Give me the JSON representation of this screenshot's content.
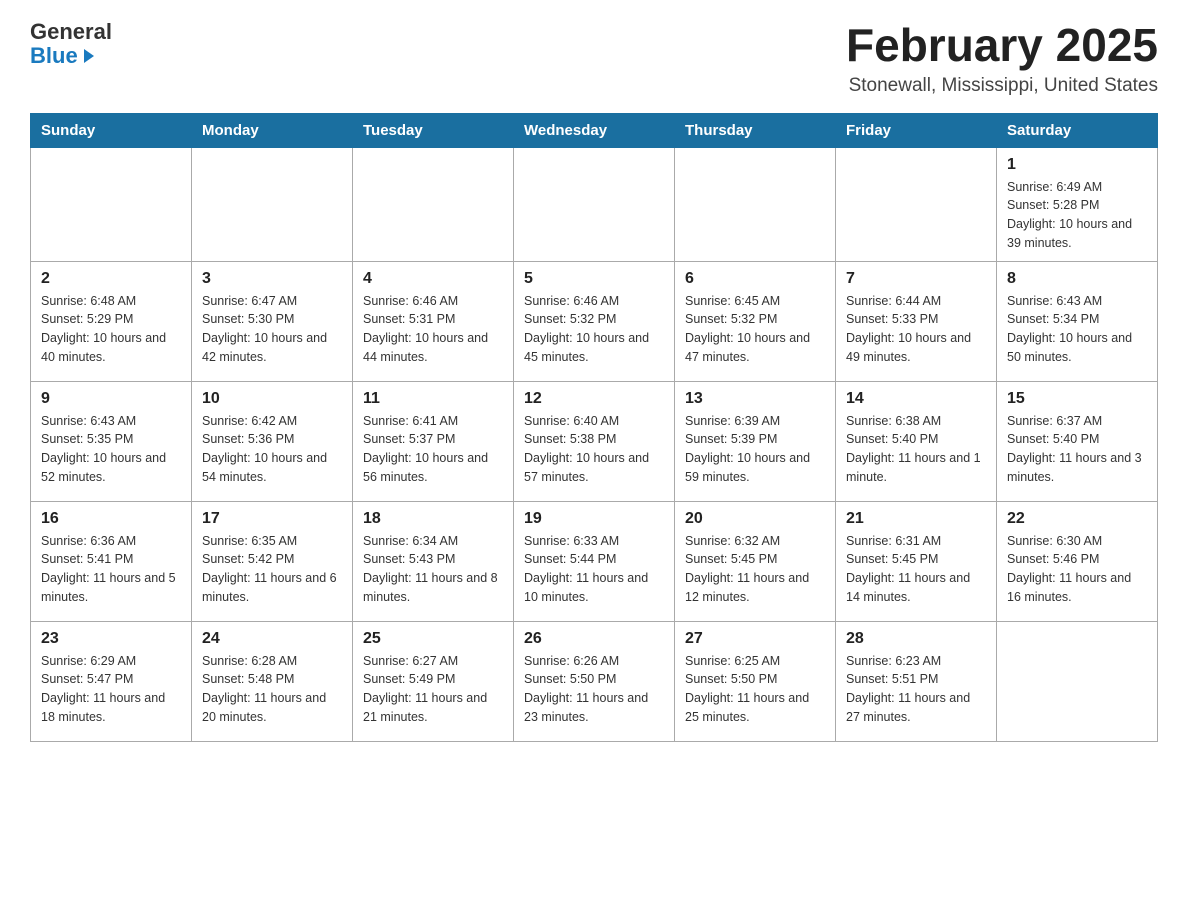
{
  "header": {
    "logo": {
      "general": "General",
      "blue": "Blue"
    },
    "title": "February 2025",
    "location": "Stonewall, Mississippi, United States"
  },
  "days_of_week": [
    "Sunday",
    "Monday",
    "Tuesday",
    "Wednesday",
    "Thursday",
    "Friday",
    "Saturday"
  ],
  "weeks": [
    [
      {
        "day": "",
        "sunrise": "",
        "sunset": "",
        "daylight": ""
      },
      {
        "day": "",
        "sunrise": "",
        "sunset": "",
        "daylight": ""
      },
      {
        "day": "",
        "sunrise": "",
        "sunset": "",
        "daylight": ""
      },
      {
        "day": "",
        "sunrise": "",
        "sunset": "",
        "daylight": ""
      },
      {
        "day": "",
        "sunrise": "",
        "sunset": "",
        "daylight": ""
      },
      {
        "day": "",
        "sunrise": "",
        "sunset": "",
        "daylight": ""
      },
      {
        "day": "1",
        "sunrise": "Sunrise: 6:49 AM",
        "sunset": "Sunset: 5:28 PM",
        "daylight": "Daylight: 10 hours and 39 minutes."
      }
    ],
    [
      {
        "day": "2",
        "sunrise": "Sunrise: 6:48 AM",
        "sunset": "Sunset: 5:29 PM",
        "daylight": "Daylight: 10 hours and 40 minutes."
      },
      {
        "day": "3",
        "sunrise": "Sunrise: 6:47 AM",
        "sunset": "Sunset: 5:30 PM",
        "daylight": "Daylight: 10 hours and 42 minutes."
      },
      {
        "day": "4",
        "sunrise": "Sunrise: 6:46 AM",
        "sunset": "Sunset: 5:31 PM",
        "daylight": "Daylight: 10 hours and 44 minutes."
      },
      {
        "day": "5",
        "sunrise": "Sunrise: 6:46 AM",
        "sunset": "Sunset: 5:32 PM",
        "daylight": "Daylight: 10 hours and 45 minutes."
      },
      {
        "day": "6",
        "sunrise": "Sunrise: 6:45 AM",
        "sunset": "Sunset: 5:32 PM",
        "daylight": "Daylight: 10 hours and 47 minutes."
      },
      {
        "day": "7",
        "sunrise": "Sunrise: 6:44 AM",
        "sunset": "Sunset: 5:33 PM",
        "daylight": "Daylight: 10 hours and 49 minutes."
      },
      {
        "day": "8",
        "sunrise": "Sunrise: 6:43 AM",
        "sunset": "Sunset: 5:34 PM",
        "daylight": "Daylight: 10 hours and 50 minutes."
      }
    ],
    [
      {
        "day": "9",
        "sunrise": "Sunrise: 6:43 AM",
        "sunset": "Sunset: 5:35 PM",
        "daylight": "Daylight: 10 hours and 52 minutes."
      },
      {
        "day": "10",
        "sunrise": "Sunrise: 6:42 AM",
        "sunset": "Sunset: 5:36 PM",
        "daylight": "Daylight: 10 hours and 54 minutes."
      },
      {
        "day": "11",
        "sunrise": "Sunrise: 6:41 AM",
        "sunset": "Sunset: 5:37 PM",
        "daylight": "Daylight: 10 hours and 56 minutes."
      },
      {
        "day": "12",
        "sunrise": "Sunrise: 6:40 AM",
        "sunset": "Sunset: 5:38 PM",
        "daylight": "Daylight: 10 hours and 57 minutes."
      },
      {
        "day": "13",
        "sunrise": "Sunrise: 6:39 AM",
        "sunset": "Sunset: 5:39 PM",
        "daylight": "Daylight: 10 hours and 59 minutes."
      },
      {
        "day": "14",
        "sunrise": "Sunrise: 6:38 AM",
        "sunset": "Sunset: 5:40 PM",
        "daylight": "Daylight: 11 hours and 1 minute."
      },
      {
        "day": "15",
        "sunrise": "Sunrise: 6:37 AM",
        "sunset": "Sunset: 5:40 PM",
        "daylight": "Daylight: 11 hours and 3 minutes."
      }
    ],
    [
      {
        "day": "16",
        "sunrise": "Sunrise: 6:36 AM",
        "sunset": "Sunset: 5:41 PM",
        "daylight": "Daylight: 11 hours and 5 minutes."
      },
      {
        "day": "17",
        "sunrise": "Sunrise: 6:35 AM",
        "sunset": "Sunset: 5:42 PM",
        "daylight": "Daylight: 11 hours and 6 minutes."
      },
      {
        "day": "18",
        "sunrise": "Sunrise: 6:34 AM",
        "sunset": "Sunset: 5:43 PM",
        "daylight": "Daylight: 11 hours and 8 minutes."
      },
      {
        "day": "19",
        "sunrise": "Sunrise: 6:33 AM",
        "sunset": "Sunset: 5:44 PM",
        "daylight": "Daylight: 11 hours and 10 minutes."
      },
      {
        "day": "20",
        "sunrise": "Sunrise: 6:32 AM",
        "sunset": "Sunset: 5:45 PM",
        "daylight": "Daylight: 11 hours and 12 minutes."
      },
      {
        "day": "21",
        "sunrise": "Sunrise: 6:31 AM",
        "sunset": "Sunset: 5:45 PM",
        "daylight": "Daylight: 11 hours and 14 minutes."
      },
      {
        "day": "22",
        "sunrise": "Sunrise: 6:30 AM",
        "sunset": "Sunset: 5:46 PM",
        "daylight": "Daylight: 11 hours and 16 minutes."
      }
    ],
    [
      {
        "day": "23",
        "sunrise": "Sunrise: 6:29 AM",
        "sunset": "Sunset: 5:47 PM",
        "daylight": "Daylight: 11 hours and 18 minutes."
      },
      {
        "day": "24",
        "sunrise": "Sunrise: 6:28 AM",
        "sunset": "Sunset: 5:48 PM",
        "daylight": "Daylight: 11 hours and 20 minutes."
      },
      {
        "day": "25",
        "sunrise": "Sunrise: 6:27 AM",
        "sunset": "Sunset: 5:49 PM",
        "daylight": "Daylight: 11 hours and 21 minutes."
      },
      {
        "day": "26",
        "sunrise": "Sunrise: 6:26 AM",
        "sunset": "Sunset: 5:50 PM",
        "daylight": "Daylight: 11 hours and 23 minutes."
      },
      {
        "day": "27",
        "sunrise": "Sunrise: 6:25 AM",
        "sunset": "Sunset: 5:50 PM",
        "daylight": "Daylight: 11 hours and 25 minutes."
      },
      {
        "day": "28",
        "sunrise": "Sunrise: 6:23 AM",
        "sunset": "Sunset: 5:51 PM",
        "daylight": "Daylight: 11 hours and 27 minutes."
      },
      {
        "day": "",
        "sunrise": "",
        "sunset": "",
        "daylight": ""
      }
    ]
  ]
}
